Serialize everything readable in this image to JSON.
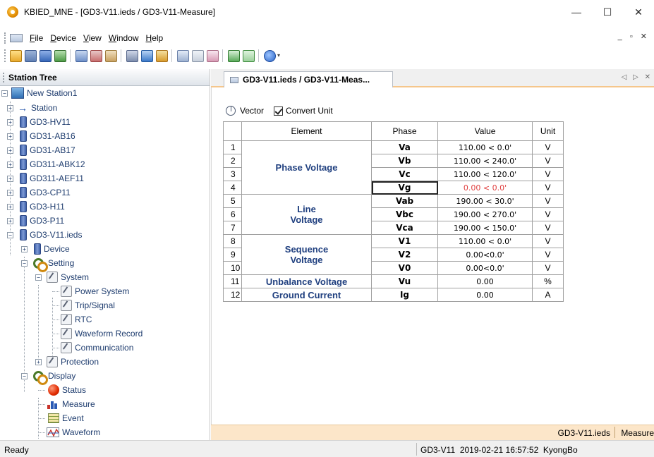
{
  "window": {
    "title": "KBIED_MNE - [GD3-V11.ieds / GD3-V11-Measure]",
    "minimize": "—",
    "maximize": "☐",
    "close": "✕"
  },
  "menu": {
    "items": [
      "File",
      "Device",
      "View",
      "Window",
      "Help"
    ],
    "mdi_controls": "_ ▫ ✕"
  },
  "left_panel": {
    "title": "Station Tree",
    "tree": {
      "root": "New Station1",
      "station": "Station",
      "devices": [
        "GD3-HV11",
        "GD31-AB16",
        "GD31-AB17",
        "GD311-ABK12",
        "GD311-AEF11",
        "GD3-CP11",
        "GD3-H11",
        "GD3-P11"
      ],
      "open_device": "GD3-V11.ieds",
      "device_node": "Device",
      "setting_node": "Setting",
      "system_node": "System",
      "system_items": [
        "Power System",
        "Trip/Signal",
        "RTC",
        "Waveform Record",
        "Communication"
      ],
      "protection_node": "Protection",
      "display_node": "Display",
      "display_items": [
        "Status",
        "Measure",
        "Event",
        "Waveform"
      ]
    }
  },
  "tab": {
    "label": "GD3-V11.ieds / GD3-V11-Meas...",
    "nav": "◁ ▷ ✕"
  },
  "options": {
    "vector_label": "Vector",
    "convert_unit_label": "Convert Unit",
    "convert_unit_checked": true
  },
  "table": {
    "headers": [
      "Element",
      "Phase",
      "Value",
      "Unit"
    ],
    "groups": [
      {
        "name": "Phase Voltage",
        "rows": 4
      },
      {
        "name": "Line\nVoltage",
        "rows": 3
      },
      {
        "name": "Sequence\nVoltage",
        "rows": 3
      },
      {
        "name": "Unbalance Voltage",
        "rows": 1
      },
      {
        "name": "Ground Current",
        "rows": 1
      }
    ],
    "rows": [
      {
        "idx": "1",
        "phase": "Va",
        "value": "110.00 < 0.0'",
        "unit": "V"
      },
      {
        "idx": "2",
        "phase": "Vb",
        "value": "110.00 < 240.0'",
        "unit": "V"
      },
      {
        "idx": "3",
        "phase": "Vc",
        "value": "110.00 < 120.0'",
        "unit": "V"
      },
      {
        "idx": "4",
        "phase": "Vg",
        "value": "0.00 < 0.0'",
        "unit": "V",
        "selected": true,
        "value_color": "#e04040"
      },
      {
        "idx": "5",
        "phase": "Vab",
        "value": "190.00 < 30.0'",
        "unit": "V"
      },
      {
        "idx": "6",
        "phase": "Vbc",
        "value": "190.00 < 270.0'",
        "unit": "V"
      },
      {
        "idx": "7",
        "phase": "Vca",
        "value": "190.00 < 150.0'",
        "unit": "V"
      },
      {
        "idx": "8",
        "phase": "V1",
        "value": "110.00 < 0.0'",
        "unit": "V"
      },
      {
        "idx": "9",
        "phase": "V2",
        "value": "0.00<0.0'",
        "unit": "V"
      },
      {
        "idx": "10",
        "phase": "V0",
        "value": "0.00<0.0'",
        "unit": "V"
      },
      {
        "idx": "11",
        "phase": "Vu",
        "value": "0.00",
        "unit": "%"
      },
      {
        "idx": "12",
        "phase": "Ig",
        "value": "0.00",
        "unit": "A"
      }
    ]
  },
  "inner_status": {
    "file": "GD3-V11.ieds",
    "view": "Measure"
  },
  "status_bar": {
    "ready": "Ready",
    "device": "GD3-V11",
    "timestamp": "2019-02-21 16:57:52",
    "user": "KyongBo"
  },
  "colors": {
    "element_text": "#1f3f7f",
    "tree_text": "#1e3c6e",
    "tab_underline": "#f5c68b",
    "inner_status_bg": "#fce6c9",
    "alarm_value": "#e04040"
  }
}
